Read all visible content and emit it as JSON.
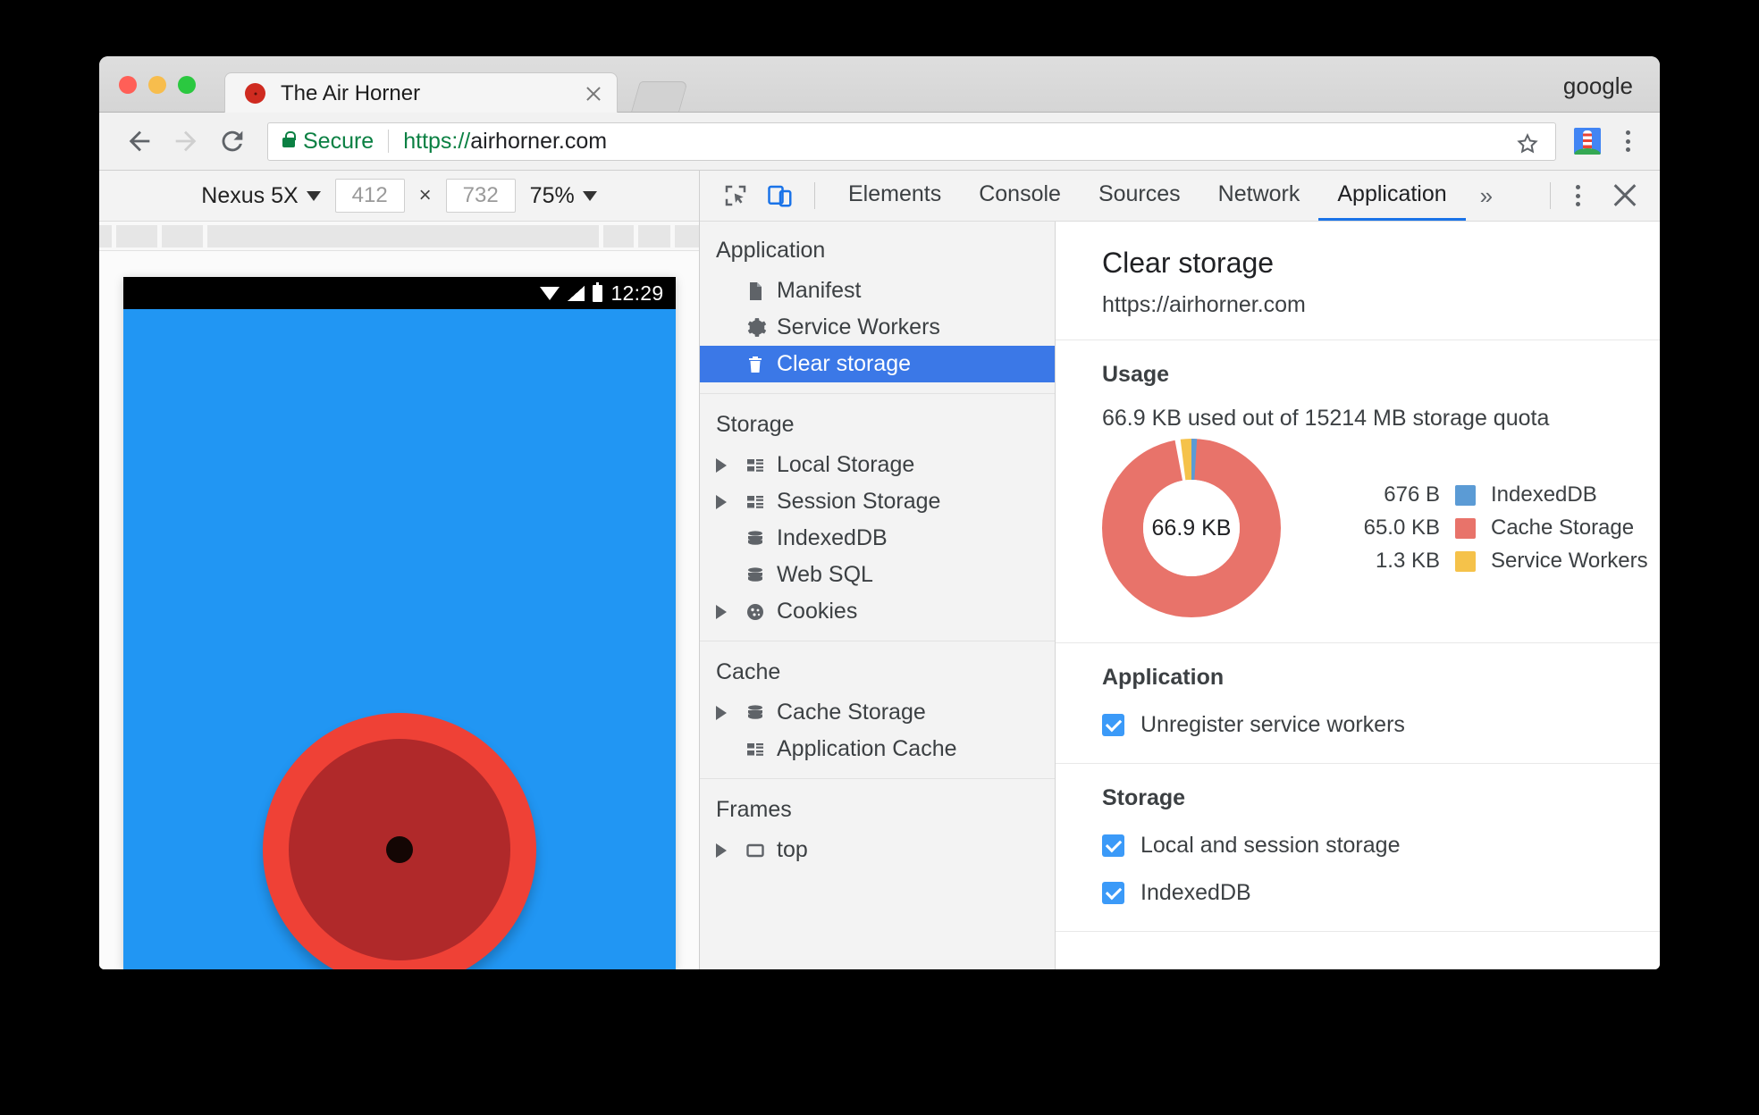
{
  "browser": {
    "profile_name": "google",
    "tab": {
      "title": "The Air Horner",
      "favicon": "airhorn-favicon",
      "close": "×"
    },
    "omnibox": {
      "security_label": "Secure",
      "url": "https://airhorner.com",
      "url_scheme": "https://",
      "url_host": "airhorner.com"
    },
    "nav": {
      "back": "back-arrow",
      "forward": "forward-arrow",
      "reload": "reload"
    }
  },
  "device_toolbar": {
    "device": "Nexus 5X",
    "width": "412",
    "height": "732",
    "separator": "×",
    "zoom": "75%"
  },
  "device_preview": {
    "status_time": "12:29",
    "page_background": "#2196f3",
    "horn_outer_color": "#ef4136",
    "horn_inner_color": "#b0292a"
  },
  "devtools": {
    "tabs": [
      {
        "label": "Elements",
        "active": false
      },
      {
        "label": "Console",
        "active": false
      },
      {
        "label": "Sources",
        "active": false
      },
      {
        "label": "Network",
        "active": false
      },
      {
        "label": "Application",
        "active": true
      }
    ],
    "more_tabs": "»",
    "accent_color": "#1a73e8",
    "sidebar": [
      {
        "header": "Application",
        "items": [
          {
            "label": "Manifest",
            "icon": "document-icon",
            "expandable": false,
            "selected": false
          },
          {
            "label": "Service Workers",
            "icon": "gear-icon",
            "expandable": false,
            "selected": false
          },
          {
            "label": "Clear storage",
            "icon": "trash-icon",
            "expandable": false,
            "selected": true
          }
        ]
      },
      {
        "header": "Storage",
        "items": [
          {
            "label": "Local Storage",
            "icon": "table-icon",
            "expandable": true,
            "selected": false
          },
          {
            "label": "Session Storage",
            "icon": "table-icon",
            "expandable": true,
            "selected": false
          },
          {
            "label": "IndexedDB",
            "icon": "database-icon",
            "expandable": false,
            "selected": false
          },
          {
            "label": "Web SQL",
            "icon": "database-icon",
            "expandable": false,
            "selected": false
          },
          {
            "label": "Cookies",
            "icon": "cookie-icon",
            "expandable": true,
            "selected": false
          }
        ]
      },
      {
        "header": "Cache",
        "items": [
          {
            "label": "Cache Storage",
            "icon": "database-icon",
            "expandable": true,
            "selected": false
          },
          {
            "label": "Application Cache",
            "icon": "table-icon",
            "expandable": false,
            "selected": false
          }
        ]
      },
      {
        "header": "Frames",
        "items": [
          {
            "label": "top",
            "icon": "frame-icon",
            "expandable": true,
            "selected": false
          }
        ]
      }
    ]
  },
  "panel": {
    "title": "Clear storage",
    "origin": "https://airhorner.com",
    "usage": {
      "section_title": "Usage",
      "summary": "66.9 KB used out of 15214 MB storage quota",
      "center_label": "66.9 KB"
    },
    "application": {
      "section_title": "Application",
      "options": [
        {
          "label": "Unregister service workers",
          "checked": true
        }
      ]
    },
    "storage": {
      "section_title": "Storage",
      "options": [
        {
          "label": "Local and session storage",
          "checked": true
        },
        {
          "label": "IndexedDB",
          "checked": true
        }
      ]
    }
  },
  "chart_data": {
    "type": "pie",
    "title": "Usage",
    "center_label": "66.9 KB",
    "total_label": "66.9 KB used out of 15214 MB storage quota",
    "legend_position": "right",
    "labels": [
      "IndexedDB",
      "Cache Storage",
      "Service Workers"
    ],
    "display_values": [
      "676 B",
      "65.0 KB",
      "1.3 KB"
    ],
    "values_bytes": [
      676,
      66560,
      1331
    ],
    "colors": [
      "#5b9bd5",
      "#e8736a",
      "#f5c24a"
    ],
    "slices": [
      {
        "label": "IndexedDB",
        "display_value": "676 B",
        "bytes": 676,
        "color": "#5b9bd5",
        "percent": 1.0
      },
      {
        "label": "Cache Storage",
        "display_value": "65.0 KB",
        "bytes": 66560,
        "color": "#e8736a",
        "percent": 97.0
      },
      {
        "label": "Service Workers",
        "display_value": "1.3 KB",
        "bytes": 1331,
        "color": "#f5c24a",
        "percent": 2.0
      }
    ]
  }
}
